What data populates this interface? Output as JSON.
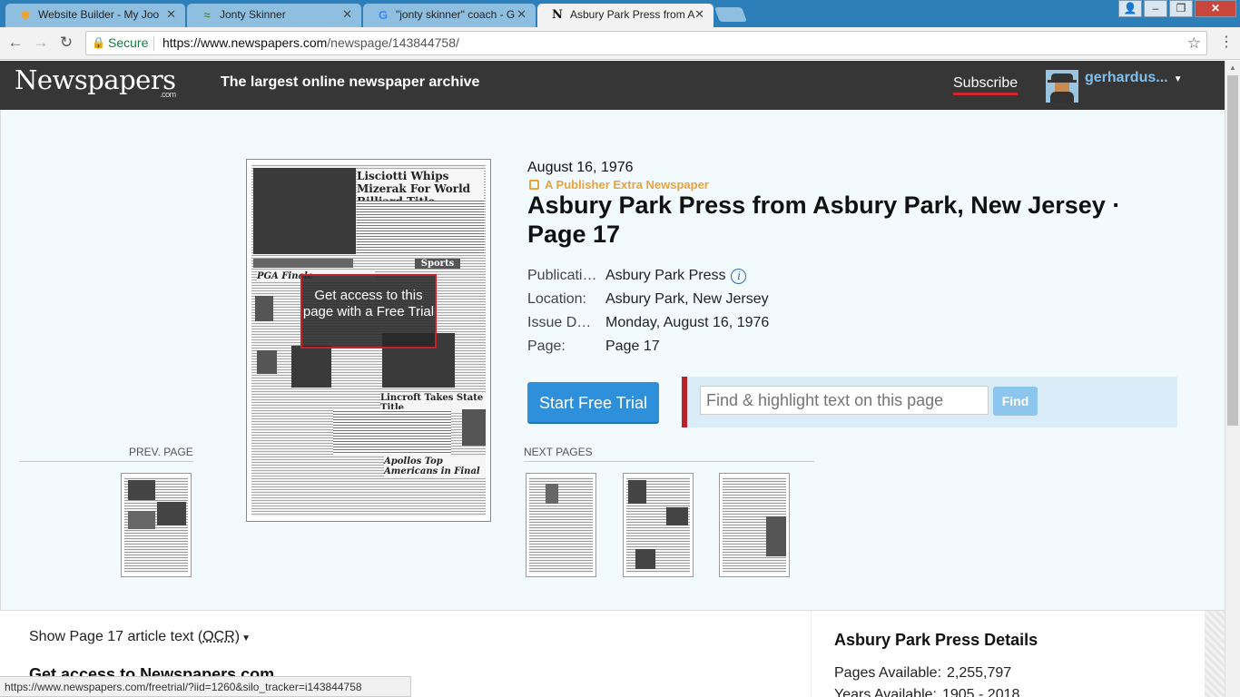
{
  "browser": {
    "tabs": [
      {
        "title": "Website Builder - My Joo",
        "favicon": "joomla-icon",
        "active": false
      },
      {
        "title": "Jonty Skinner",
        "favicon": "site-favicon-icon",
        "active": false
      },
      {
        "title": "\"jonty skinner\" coach - G",
        "favicon": "google-icon",
        "active": false
      },
      {
        "title": "Asbury Park Press from A",
        "favicon": "newspapers-icon",
        "active": true
      }
    ],
    "secure_label": "Secure",
    "url_scheme_host": "https://www.newspapers.com",
    "url_path": "/newspage/143844758/",
    "status_url": "https://www.newspapers.com/freetrial/?iid=1260&silo_tracker=i143844758"
  },
  "header": {
    "logo": "Newspapers",
    "logo_suffix": ".com",
    "tagline": "The largest online newspaper archive",
    "subscribe": "Subscribe",
    "username": "gerhardus..."
  },
  "page": {
    "date": "August 16, 1976",
    "publisher_extra": "A Publisher Extra Newspaper",
    "title": "Asbury Park Press from Asbury Park, New Jersey · Page 17",
    "meta": [
      {
        "key": "Publication:",
        "value": "Asbury Park Press"
      },
      {
        "key": "Location:",
        "value": "Asbury Park, New Jersey"
      },
      {
        "key": "Issue Date:",
        "value": "Monday, August 16, 1976"
      },
      {
        "key": "Page:",
        "value": "Page 17"
      }
    ],
    "overlay_text": "Get access to this page with a Free Trial",
    "start_trial": "Start Free Trial",
    "find_placeholder": "Find & highlight text on this page",
    "find_button": "Find",
    "prev_label": "PREV. PAGE",
    "next_label": "NEXT PAGES"
  },
  "thumbnail": {
    "headline1": "Lisciotti Whips Mizerak For World Billiard Title",
    "headline2": "PGA Finale",
    "headline3": "Lincroft Takes State Title",
    "headline4": "Apollos Top Americans in Final",
    "section": "Sports"
  },
  "lower": {
    "ocr_prefix": "Show Page 17 article text (",
    "ocr_abbr": "OCR",
    "ocr_suffix": ")",
    "access_heading": "Get access to Newspapers.com",
    "details_title": "Asbury Park Press Details",
    "details": [
      {
        "key": "Pages Available:",
        "value": "2,255,797"
      },
      {
        "key": "Years Available:",
        "value": "1905 - 2018"
      }
    ]
  }
}
